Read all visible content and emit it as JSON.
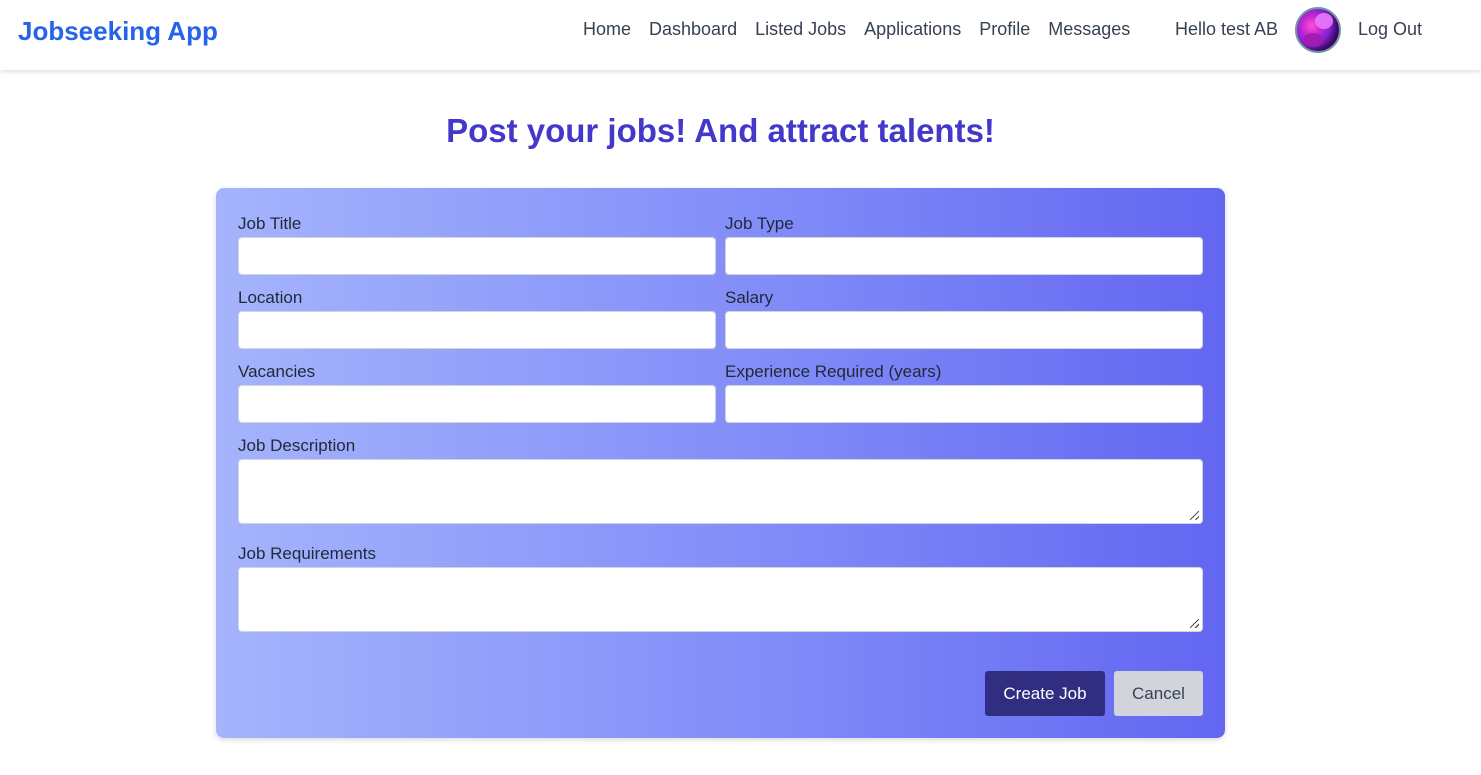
{
  "navbar": {
    "brand": "Jobseeking App",
    "links": [
      "Home",
      "Dashboard",
      "Listed Jobs",
      "Applications",
      "Profile",
      "Messages"
    ],
    "greeting": "Hello test AB",
    "logout": "Log Out"
  },
  "page": {
    "heading": "Post your jobs! And attract talents!"
  },
  "form": {
    "job_title": {
      "label": "Job Title",
      "value": ""
    },
    "job_type": {
      "label": "Job Type",
      "value": ""
    },
    "location": {
      "label": "Location",
      "value": ""
    },
    "salary": {
      "label": "Salary",
      "value": ""
    },
    "vacancies": {
      "label": "Vacancies",
      "value": ""
    },
    "experience": {
      "label": "Experience Required (years)",
      "value": ""
    },
    "description": {
      "label": "Job Description",
      "value": ""
    },
    "requirements": {
      "label": "Job Requirements",
      "value": ""
    },
    "create_label": "Create Job",
    "cancel_label": "Cancel"
  },
  "colors": {
    "brand": "#2563eb",
    "heading": "#4338ca",
    "card_gradient_start": "#a5b4fc",
    "card_gradient_end": "#6366f1",
    "create_button": "#312e81",
    "cancel_button": "#d1d5db"
  }
}
